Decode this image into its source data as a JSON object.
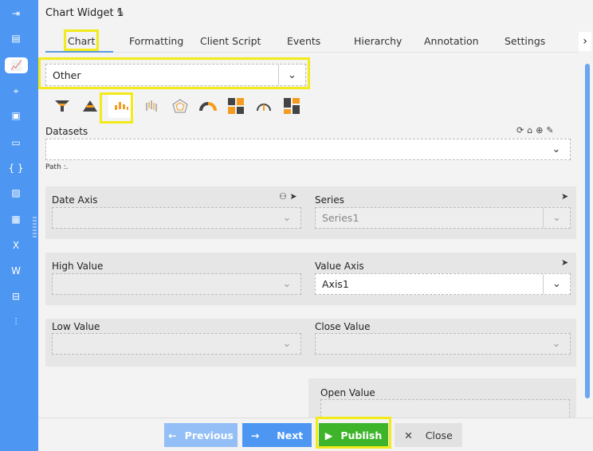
{
  "sidebar": {
    "icons": [
      "sign-in-icon",
      "form-icon",
      "chart-icon",
      "map-icon",
      "document-icon",
      "id-card-icon",
      "code-icon",
      "image-icon",
      "calendar-icon",
      "excel-icon",
      "word-icon",
      "hierarchy-icon",
      "report-icon"
    ],
    "active": "chart-icon",
    "glyphs": [
      "⇥",
      "▤",
      "📈",
      "🗺",
      "▣",
      "▭",
      "{ }",
      "▨",
      "▦",
      "X",
      "W",
      "⊟",
      "⫶"
    ]
  },
  "header": {
    "title": "Chart Widget 1"
  },
  "tabs": [
    "Chart",
    "Formatting",
    "Client Script",
    "Events",
    "Hierarchy",
    "Annotation",
    "Settings"
  ],
  "chart_type": {
    "value": "Other"
  },
  "chart_icons": [
    "funnel-icon",
    "pyramid-icon",
    "candlestick-icon",
    "ohlc-icon",
    "radar-icon",
    "semi-donut-icon",
    "heatmap-icon",
    "gauge-icon",
    "treemap-icon"
  ],
  "datasets": {
    "label": "Datasets",
    "value": "",
    "path": "Path :."
  },
  "fields": {
    "date_axis": {
      "label": "Date Axis",
      "value": ""
    },
    "series": {
      "label": "Series",
      "value": "Series1"
    },
    "high_value": {
      "label": "High Value",
      "value": ""
    },
    "value_axis": {
      "label": "Value Axis",
      "value": "Axis1"
    },
    "low_value": {
      "label": "Low Value",
      "value": ""
    },
    "close_value": {
      "label": "Close Value",
      "value": ""
    },
    "open_value": {
      "label": "Open Value",
      "value": ""
    }
  },
  "footer": {
    "previous": "Previous",
    "next": "Next",
    "publish": "Publish",
    "close": "Close"
  },
  "colors": {
    "sidebar": "#4d97f3",
    "publish": "#3db42a",
    "next": "#4d97f3",
    "highlight": "#f2ea1a",
    "icon_orange": "#f39c1f"
  }
}
